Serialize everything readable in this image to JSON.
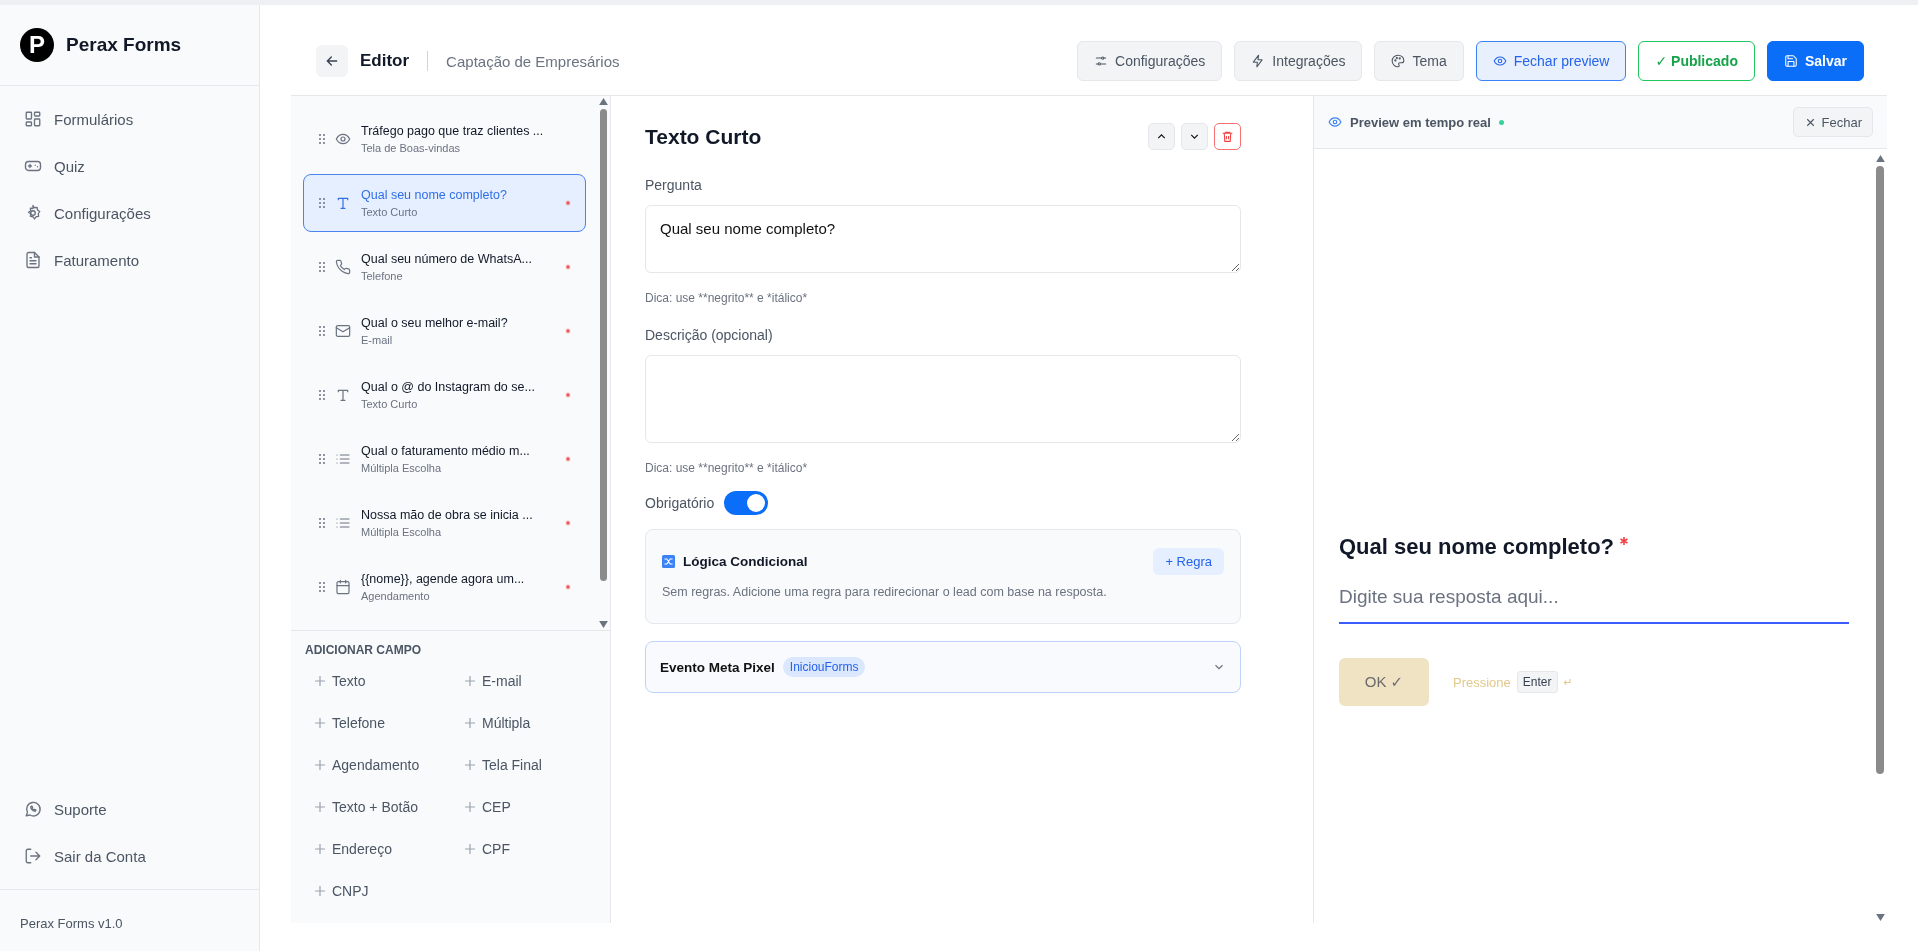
{
  "brand": {
    "name": "Perax Forms",
    "mark": "P"
  },
  "nav": [
    {
      "label": "Formulários",
      "kind": "grid"
    },
    {
      "label": "Quiz",
      "kind": "gamepad"
    },
    {
      "label": "Configurações",
      "kind": "gear"
    },
    {
      "label": "Faturamento",
      "kind": "doc"
    }
  ],
  "nav_bottom": [
    {
      "label": "Suporte",
      "kind": "chat"
    },
    {
      "label": "Sair da Conta",
      "kind": "logout"
    }
  ],
  "version": "Perax Forms v1.0",
  "header": {
    "title": "Editor",
    "form_name": "Captação de Empresários"
  },
  "toolbar": [
    {
      "label": "Configurações",
      "kind": "settings"
    },
    {
      "label": "Integrações",
      "kind": "integrations"
    },
    {
      "label": "Tema",
      "kind": "theme"
    },
    {
      "label": "Fechar preview",
      "kind": "preview"
    },
    {
      "label": "✓ Publicado",
      "kind": "published"
    },
    {
      "label": "Salvar",
      "kind": "save"
    }
  ],
  "fields": [
    {
      "title": "Tráfego pago que traz clientes ...",
      "type": "Tela de Boas-vindas",
      "kind": "eye",
      "required": false,
      "selected": false
    },
    {
      "title": "Qual seu nome completo?",
      "type": "Texto Curto",
      "kind": "text",
      "required": true,
      "selected": true
    },
    {
      "title": "Qual seu número de WhatsA...",
      "type": "Telefone",
      "kind": "phone",
      "required": true,
      "selected": false
    },
    {
      "title": "Qual o seu melhor e-mail?",
      "type": "E-mail",
      "kind": "mail",
      "required": true,
      "selected": false
    },
    {
      "title": "Qual o @ do Instagram do se...",
      "type": "Texto Curto",
      "kind": "text",
      "required": true,
      "selected": false
    },
    {
      "title": "Qual o faturamento médio m...",
      "type": "Múltipla Escolha",
      "kind": "list",
      "required": true,
      "selected": false
    },
    {
      "title": "Nossa mão de obra se inicia ...",
      "type": "Múltipla Escolha",
      "kind": "list",
      "required": true,
      "selected": false
    },
    {
      "title": "{{nome}}, agende agora um...",
      "type": "Agendamento",
      "kind": "calendar",
      "required": true,
      "selected": false
    }
  ],
  "add_field": {
    "heading": "ADICIONAR CAMPO",
    "items": [
      "Texto",
      "E-mail",
      "Telefone",
      "Múltipla",
      "Agendamento",
      "Tela Final",
      "Texto + Botão",
      "CEP",
      "Endereço",
      "CPF",
      "CNPJ"
    ]
  },
  "editor": {
    "title": "Texto Curto",
    "question_label": "Pergunta",
    "question_value": "Qual seu nome completo?",
    "question_hint": "Dica: use **negrito** e *itálico*",
    "description_label": "Descrição (opcional)",
    "description_hint": "Dica: use **negrito** e *itálico*",
    "required_label": "Obrigatório",
    "required": true,
    "logic": {
      "title": "Lógica Condicional",
      "button": "+ Regra",
      "text": "Sem regras. Adicione uma regra para redirecionar o lead com base na resposta."
    },
    "pixel": {
      "label": "Evento Meta Pixel",
      "badge": "IniciouForms",
      "expanded": false
    }
  },
  "preview": {
    "title": "Preview em tempo real",
    "live": true,
    "close": "Fechar",
    "question": "Qual seu nome completo?",
    "required": true,
    "placeholder": "Digite sua resposta aqui...",
    "ok": "OK ✓",
    "press": "Pressione",
    "key": "Enter",
    "enter_symbol": "↵"
  }
}
